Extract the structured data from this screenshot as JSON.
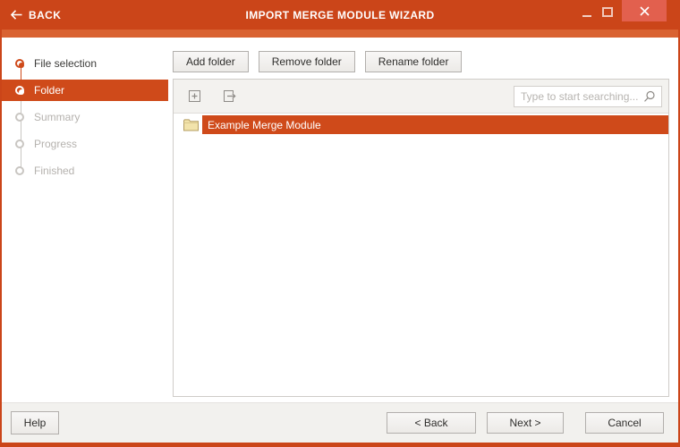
{
  "titlebar": {
    "back_label": "BACK",
    "title": "IMPORT MERGE MODULE WIZARD"
  },
  "wizard_steps": [
    {
      "label": "File selection",
      "state": "done"
    },
    {
      "label": "Folder",
      "state": "current"
    },
    {
      "label": "Summary",
      "state": "upcoming"
    },
    {
      "label": "Progress",
      "state": "upcoming"
    },
    {
      "label": "Finished",
      "state": "upcoming"
    }
  ],
  "folder_actions": {
    "add": "Add folder",
    "remove": "Remove folder",
    "rename": "Rename folder"
  },
  "tree": {
    "search_placeholder": "Type to start searching...",
    "selected_item": "Example Merge Module"
  },
  "footer": {
    "help": "Help",
    "back": "< Back",
    "next": "Next >",
    "cancel": "Cancel"
  },
  "colors": {
    "titlebar": "#cb4519",
    "accent_strip": "#d96231",
    "selection": "#cf4a1a",
    "close_button": "#e2604e"
  }
}
